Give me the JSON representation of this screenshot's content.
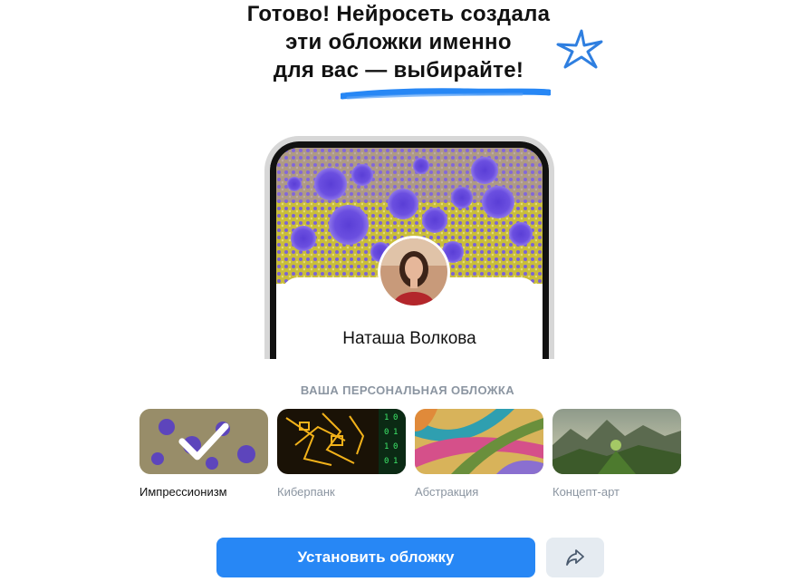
{
  "headline": {
    "line1": "Готово! Нейросеть создала",
    "line2": "эти обложки именно",
    "line3": "для вас — выбирайте!"
  },
  "profile": {
    "name": "Наташа Волкова"
  },
  "covers": {
    "section_label": "ВАША ПЕРСОНАЛЬНАЯ ОБЛОЖКА",
    "items": [
      {
        "label": "Импрессионизм",
        "selected": true
      },
      {
        "label": "Киберпанк",
        "selected": false
      },
      {
        "label": "Абстракция",
        "selected": false
      },
      {
        "label": "Концепт-арт",
        "selected": false
      }
    ]
  },
  "actions": {
    "install_label": "Установить обложку",
    "share_icon": "share-arrow-icon"
  },
  "colors": {
    "accent": "#2787f5",
    "secondary_button": "#e5ebf1",
    "muted_text": "#8b95a1"
  }
}
